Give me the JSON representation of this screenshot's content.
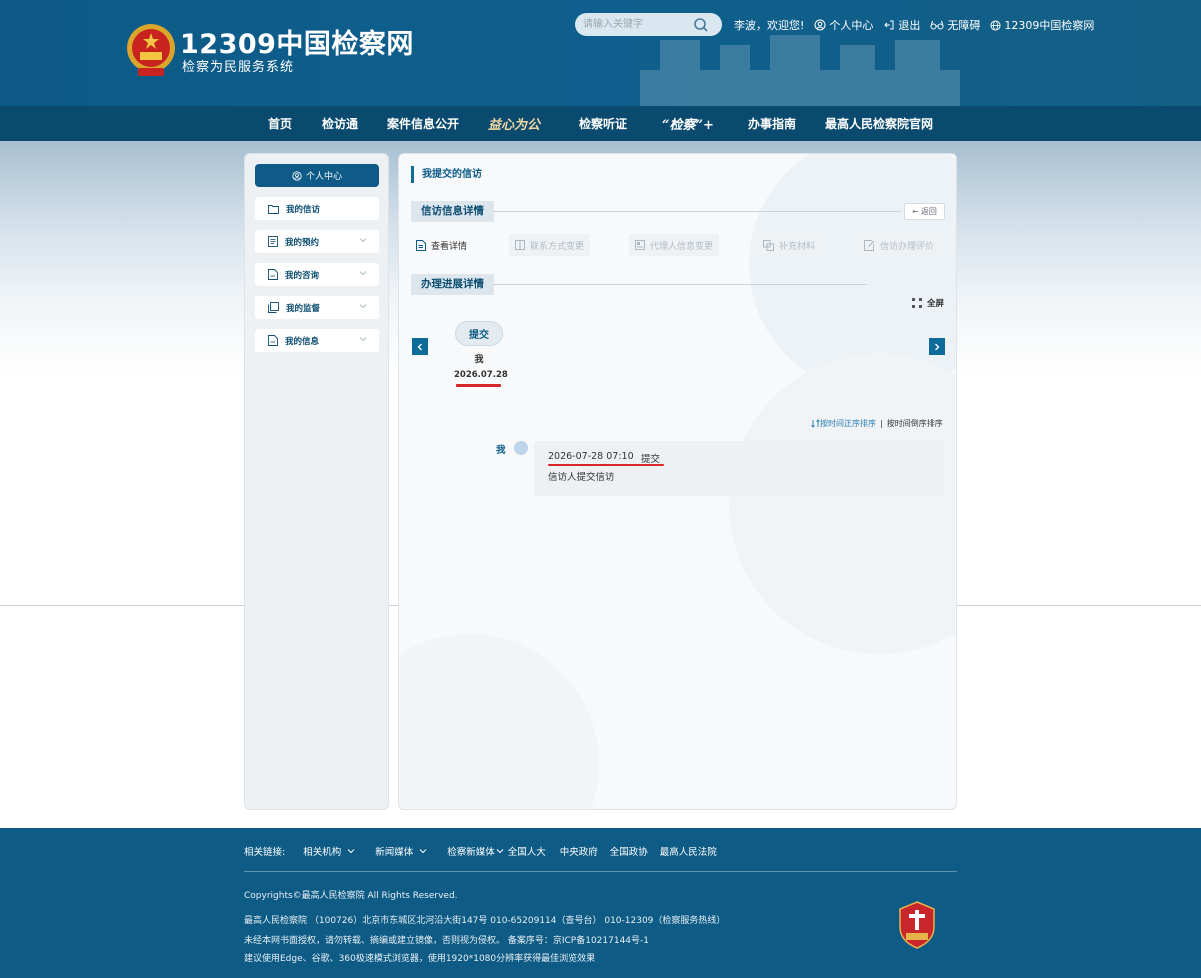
{
  "header": {
    "logo_main": "12309中国检察网",
    "logo_sub": "检察为民服务系统",
    "search_placeholder": "请输入关键字",
    "welcome": "李波，欢迎您!",
    "user_center": "个人中心",
    "logout": "退出",
    "accessibility": "无障碍",
    "site_link": "12309中国检察网"
  },
  "nav": {
    "items": [
      "首页",
      "检访通",
      "案件信息公开",
      "益心为公",
      "检察听证",
      "“检察”+",
      "办事指南",
      "最高人民检察院官网"
    ]
  },
  "sidebar": {
    "header": "个人中心",
    "items": [
      {
        "label": "我的信访",
        "icon": "folder-icon"
      },
      {
        "label": "我的预约",
        "icon": "document-list-icon"
      },
      {
        "label": "我的咨询",
        "icon": "document-icon"
      },
      {
        "label": "我的监督",
        "icon": "documents-icon"
      },
      {
        "label": "我的信息",
        "icon": "document-icon"
      }
    ]
  },
  "main": {
    "title": "我提交的信访",
    "info_section": "信访信息详情",
    "back": "返回",
    "actions": {
      "view": "查看详情",
      "contact": "联系方式变更",
      "agent": "代理人信息变更",
      "supplement": "补充材料",
      "evaluate": "信访办理评价"
    },
    "progress_section": "办理进展详情",
    "fullscreen": "全屏",
    "step": {
      "label": "提交",
      "who": "我",
      "date": "2026.07.28"
    },
    "sort_asc": "按时间正序排序",
    "sort_sep": "|",
    "sort_desc": "按时间倒序排序",
    "timeline": {
      "who": "我",
      "time": "2026-07-28 07:10",
      "type": "提交",
      "desc": "信访人提交信访"
    }
  },
  "footer": {
    "links_label": "相关链接:",
    "links": [
      "相关机构",
      "新闻媒体",
      "检察新媒体",
      "全国人大",
      "中央政府",
      "全国政协",
      "最高人民法院"
    ],
    "copyright": "Copyrights©最高人民检察院 All Rights Reserved.",
    "address": "最高人民检察院 （100726）北京市东城区北河沿大街147号 010-65209114（查号台） 010-12309（检察服务热线）",
    "license": "未经本网书面授权，请勿转载、摘编或建立镜像，否则视为侵权。 备案序号：京ICP备10217144号-1",
    "browser": "建议使用Edge、谷歌、360极速模式浏览器，使用1920*1080分辨率获得最佳浏览效果"
  },
  "colors": {
    "header_bg": "#0e5f8d",
    "nav_bg": "#0a4a6e",
    "accent": "#0d5b86",
    "highlight_red": "#d7262c"
  }
}
